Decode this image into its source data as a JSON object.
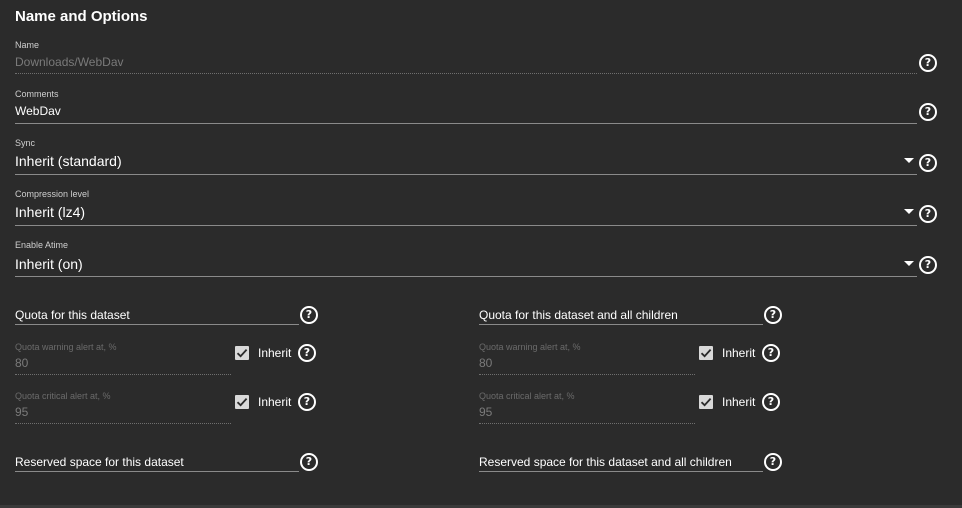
{
  "section": {
    "title": "Name and Options"
  },
  "fields": {
    "name": {
      "label": "Name",
      "value": "Downloads/WebDav"
    },
    "comments": {
      "label": "Comments",
      "value": "WebDav"
    },
    "sync": {
      "label": "Sync",
      "value": "Inherit (standard)"
    },
    "compression": {
      "label": "Compression level",
      "value": "Inherit (lz4)"
    },
    "atime": {
      "label": "Enable Atime",
      "value": "Inherit (on)"
    }
  },
  "quota_left": {
    "quota_label": "Quota for this dataset",
    "warning": {
      "label": "Quota warning alert at, %",
      "value": "80",
      "inherit_label": "Inherit",
      "checked": true
    },
    "critical": {
      "label": "Quota critical alert at, %",
      "value": "95",
      "inherit_label": "Inherit",
      "checked": true
    },
    "reserved_label": "Reserved space for this dataset"
  },
  "quota_right": {
    "quota_label": "Quota for this dataset and all children",
    "warning": {
      "label": "Quota warning alert at, %",
      "value": "80",
      "inherit_label": "Inherit",
      "checked": true
    },
    "critical": {
      "label": "Quota critical alert at, %",
      "value": "95",
      "inherit_label": "Inherit",
      "checked": true
    },
    "reserved_label": "Reserved space for this dataset and all children"
  },
  "icons": {
    "help": "help-circle-icon",
    "dropdown": "caret-down-icon",
    "check": "check-icon"
  },
  "colors": {
    "background": "#2b2b2b",
    "text": "#ffffff",
    "disabled": "#7a7a7a",
    "checkbox": "#d9d9d9"
  },
  "glyphs": {
    "help": "?"
  }
}
